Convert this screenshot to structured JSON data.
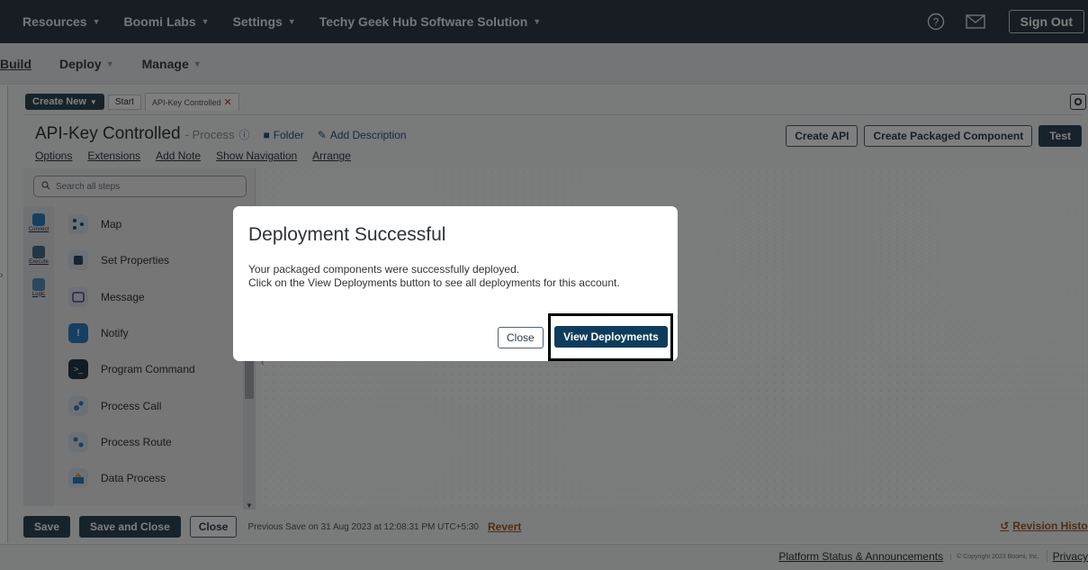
{
  "topnav": {
    "items": [
      "Resources",
      "Boomi Labs",
      "Settings",
      "Techy Geek Hub Software Solution"
    ],
    "help_icon": "help-circle-icon",
    "mail_icon": "mail-icon",
    "sign_out": "Sign Out"
  },
  "subnav": {
    "build": "Build",
    "deploy": "Deploy",
    "manage": "Manage"
  },
  "tabs": {
    "create_new": "Create New",
    "start": "Start",
    "active": "API-Key Controlled",
    "close_x": "✕"
  },
  "process": {
    "name": "API-Key Controlled",
    "type": "- Process",
    "folder": "Folder",
    "add_description": "Add Description",
    "links": [
      "Options",
      "Extensions",
      "Add Note",
      "Show Navigation",
      "Arrange"
    ],
    "actions": [
      "Create API",
      "Create Packaged Component",
      "Test"
    ]
  },
  "palette": {
    "search_placeholder": "Search all steps",
    "categories": [
      "Connect",
      "Execute",
      "Logic"
    ],
    "steps": [
      "Map",
      "Set Properties",
      "Message",
      "Notify",
      "Program Command",
      "Process Call",
      "Process Route",
      "Data Process"
    ]
  },
  "savebar": {
    "save": "Save",
    "save_close": "Save and Close",
    "close": "Close",
    "previous_save": "Previous Save on 31 Aug 2023 at 12:08:31 PM UTC+5:30",
    "revert": "Revert",
    "revision_history": "Revision History"
  },
  "footer": {
    "platform_status": "Platform Status & Announcements",
    "copyright": "© Copyright 2023 Boomi, Inc.",
    "privacy": "Privacy"
  },
  "modal": {
    "title": "Deployment Successful",
    "line1": "Your packaged components were successfully deployed.",
    "line2": "Click on the View Deployments button to see all deployments for this account.",
    "close": "Close",
    "view_deployments": "View Deployments"
  },
  "colors": {
    "topnav_bg": "#2f3b45",
    "primary_btn": "#0e3c5c",
    "link_accent": "#a35a2c"
  }
}
